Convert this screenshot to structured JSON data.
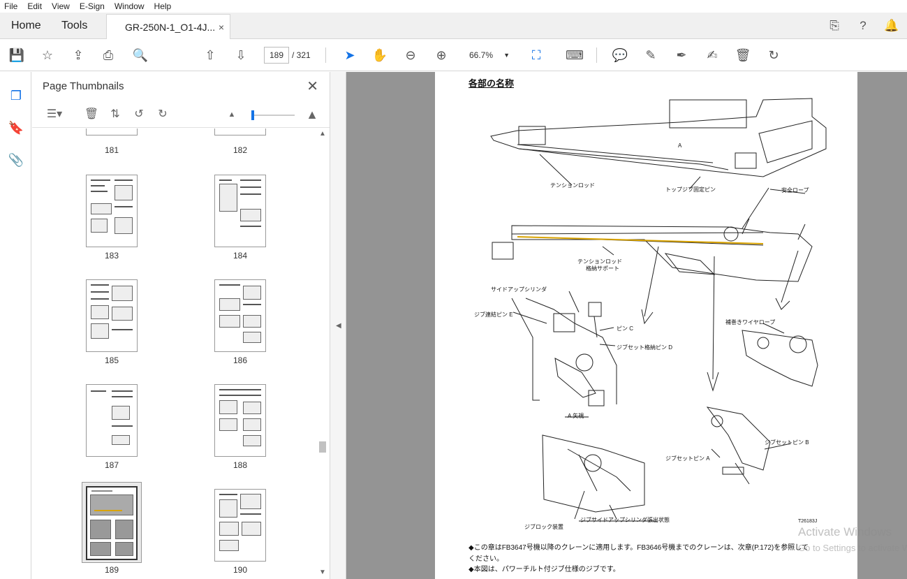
{
  "menu": [
    "File",
    "Edit",
    "View",
    "E-Sign",
    "Window",
    "Help"
  ],
  "tabs": {
    "home": "Home",
    "tools": "Tools",
    "document": "GR-250N-1_O1-4J...",
    "close": "×"
  },
  "toolbar": {
    "current_page": "189",
    "total_pages": "/  321",
    "zoom": "66.7%"
  },
  "panel": {
    "title": "Page Thumbnails"
  },
  "thumbnails": [
    "181",
    "182",
    "183",
    "184",
    "185",
    "186",
    "187",
    "188",
    "189",
    "190"
  ],
  "document": {
    "section_title": "各部の名称",
    "labels": {
      "tension_rod": "テンションロッド",
      "top_jib_pin": "トップジブ固定ピン",
      "safety_rope": "安全ロープ",
      "tension_rod_support": "テンションロッド",
      "tension_rod_support2": "格納サポート",
      "side_up_cylinder": "サイドアップシリンダ",
      "jib_pin_e": "ジブ連結ピン E",
      "pin_c": "ピン C",
      "jib_set_pin_d": "ジブセット格納ピン D",
      "aux_wire": "補巻きワイヤロープ",
      "view_a": "A 矢視",
      "jib_set_pin_b": "ジブセットピン B",
      "jib_set_pin_a": "ジブセットピン A",
      "jib_lock": "ジブロック装置",
      "cylinder_extended": "ジブサイドアップシリンダ張出状態",
      "arrow_a": "A",
      "figure_code": "T26183J"
    },
    "notes": [
      "◆この章はFB3647号機以降のクレーンに適用します。FB3646号機までのクレーンは、次章(P.172)を参照して",
      "ください。",
      "◆本図は、パワーチルト付ジブ仕様のジブです。"
    ]
  },
  "watermark": {
    "line1": "Activate Windows",
    "line2": "Go to Settings to activate Windows."
  }
}
